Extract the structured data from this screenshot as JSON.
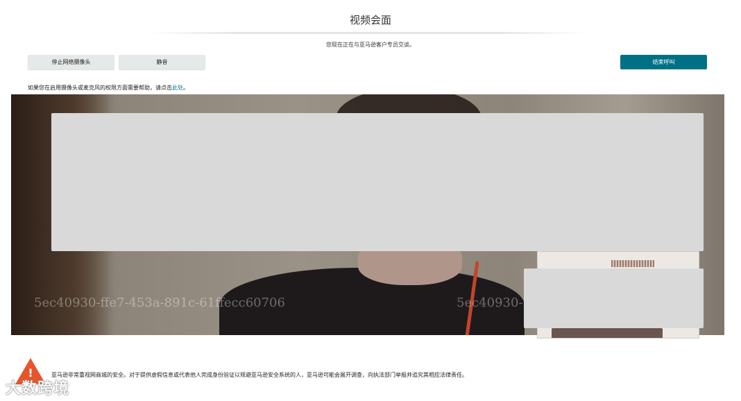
{
  "header": {
    "title": "视频会面",
    "subtitle": "您现在正在与亚马逊客户专员交谈。"
  },
  "toolbar": {
    "stop_webcam_label": "停止网络摄像头",
    "mute_label": "静音",
    "end_call_label": "结束呼叫",
    "colors": {
      "primary": "#007185",
      "secondary": "#e6e9ea"
    }
  },
  "help": {
    "text": "如果您在启用摄像头或麦克风的权限方面需要帮助，请点击",
    "link_text": "此处",
    "suffix": "。"
  },
  "video": {
    "watermark": "5ec40930-ffe7-453a-891c-61ffecc60706",
    "watermark_right": "5ec40930-"
  },
  "footer": {
    "notice": "亚马逊非常重视网商城的安全。对于提供虚假信息或代表他人完成身份验证以规避亚马逊安全系统的人，亚马逊可能会展开调查，向执法部门举报并追究其相应法律责任。",
    "warning_mark": "!",
    "brand_logo": "大数跨境"
  }
}
